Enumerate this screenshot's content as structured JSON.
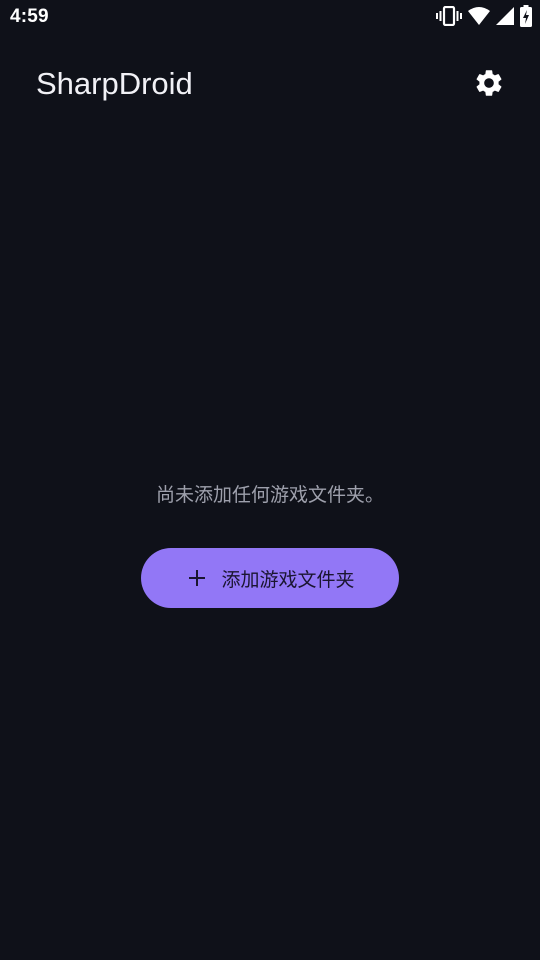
{
  "status_bar": {
    "time": "4:59",
    "icons": [
      "vibrate-icon",
      "wifi-icon",
      "signal-icon",
      "battery-charging-icon"
    ]
  },
  "app_bar": {
    "title": "SharpDroid",
    "settings_icon": "gear-icon"
  },
  "empty_state": {
    "message": "尚未添加任何游戏文件夹。",
    "button_label": "添加游戏文件夹",
    "button_icon": "plus-icon"
  },
  "colors": {
    "background": "#0f1119",
    "accent": "#9277f6",
    "text_secondary": "#9ea0ac",
    "on_accent": "#1a1530"
  }
}
